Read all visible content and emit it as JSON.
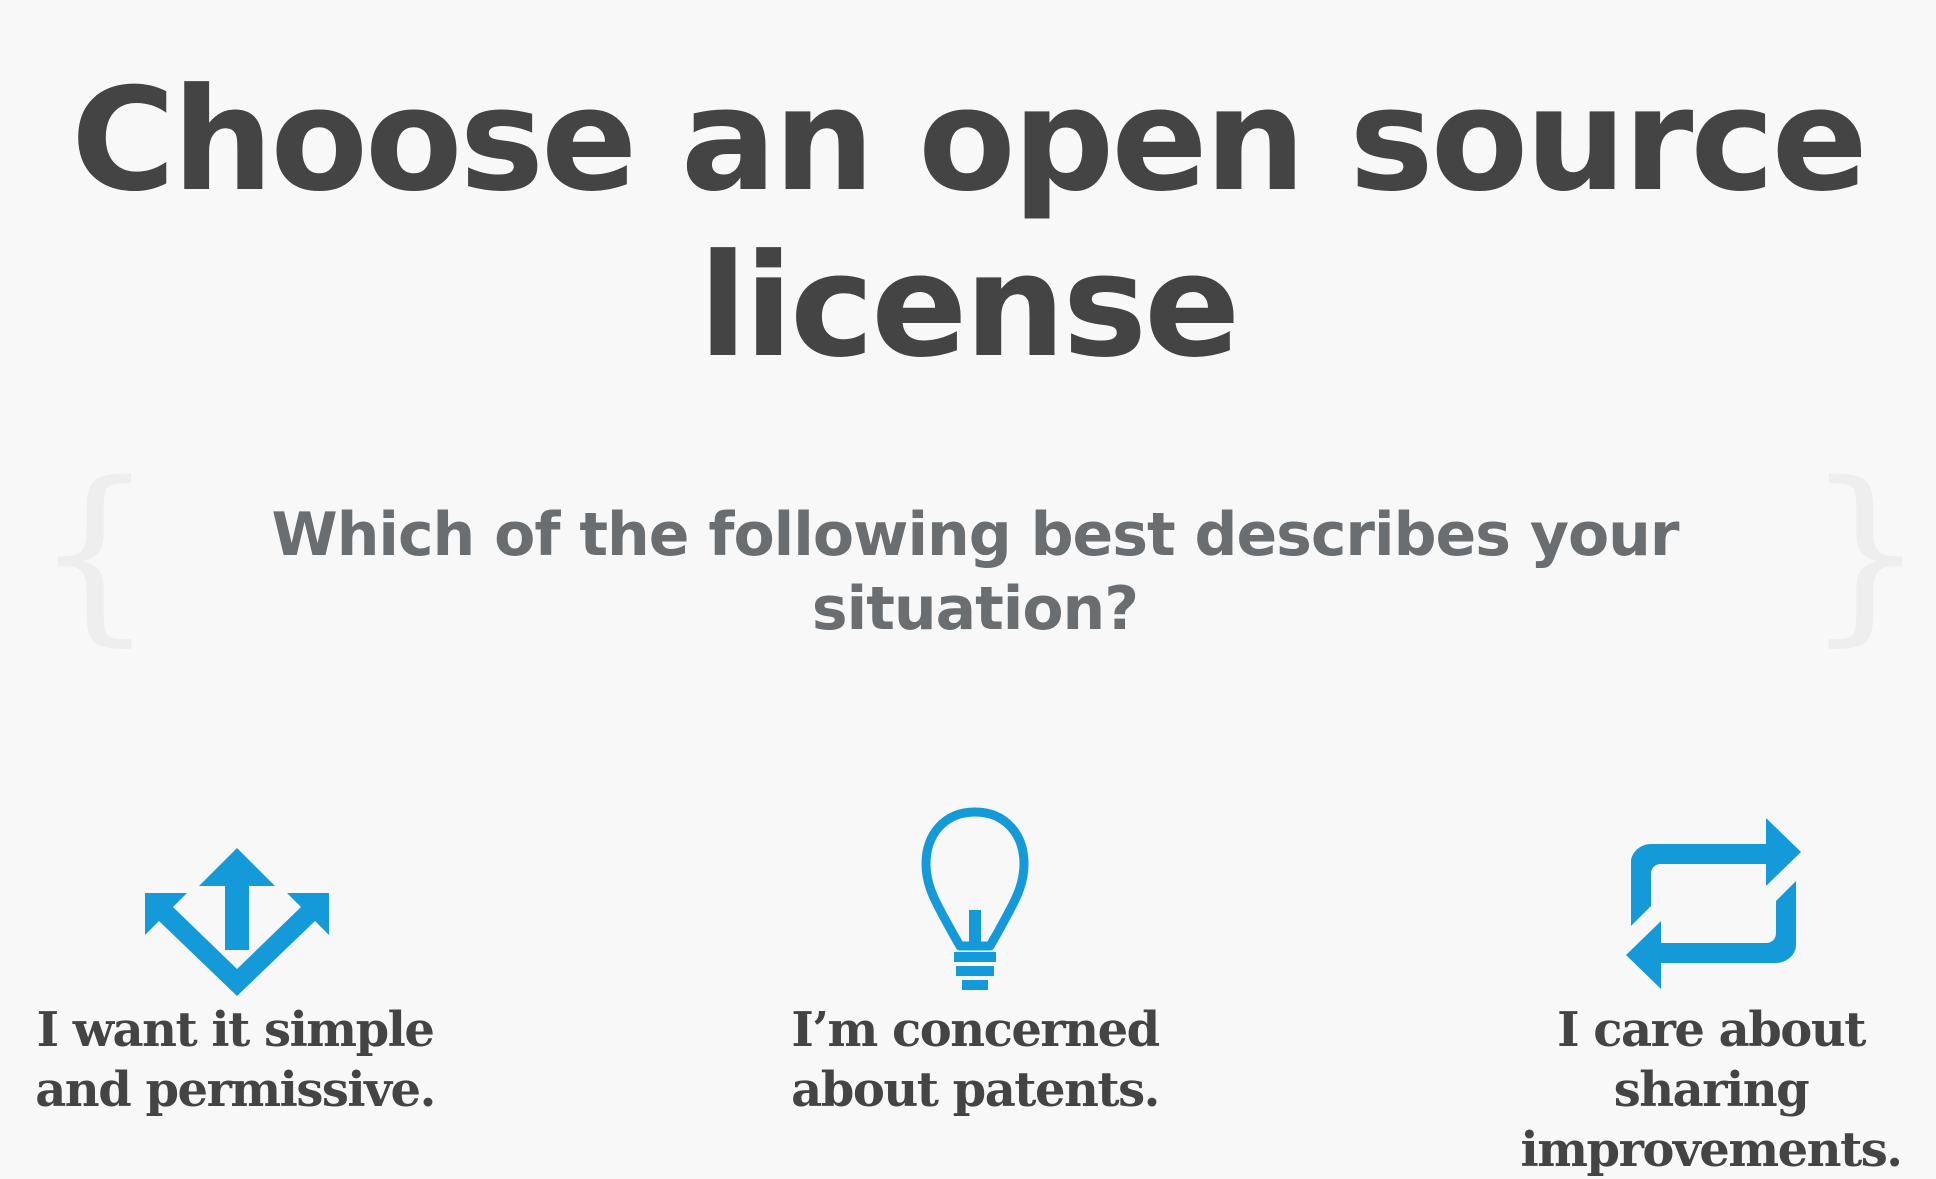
{
  "header": {
    "title": "Choose an open source license"
  },
  "question": {
    "text": "Which of the following best describes your situation?"
  },
  "options": [
    {
      "label": "I want it simple and permissive.",
      "icon": "arrows-split-icon"
    },
    {
      "label": "I’m concerned about patents.",
      "icon": "lightbulb-icon"
    },
    {
      "label": "I care about sharing improvements.",
      "icon": "repeat-arrows-icon"
    }
  ],
  "colors": {
    "title": "#444445",
    "question": "#6a6e70",
    "icon_accent": "#149ad9",
    "background": "#f8f8f8",
    "brace": "#eeeeee"
  }
}
